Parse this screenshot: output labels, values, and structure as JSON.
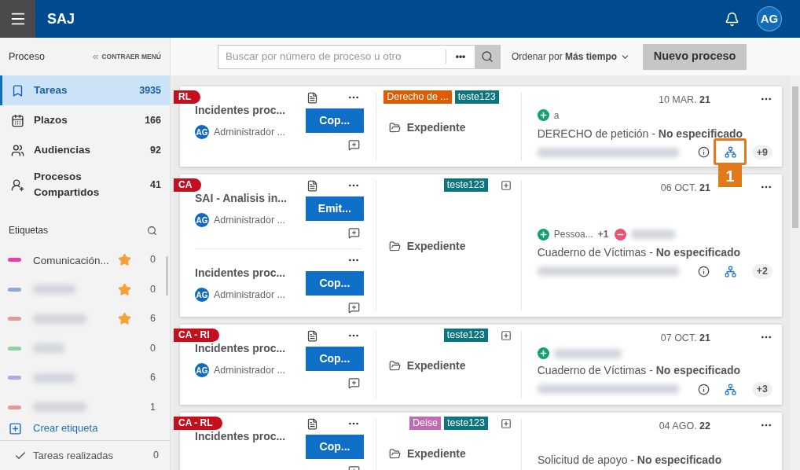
{
  "header": {
    "brand": "SAJ",
    "avatar": "AG"
  },
  "sidebar": {
    "title": "Proceso",
    "collapse": "CONTRAER MENÚ",
    "nav": [
      {
        "kind": "tasks",
        "label": "Tareas",
        "count": "3935",
        "selected": true
      },
      {
        "kind": "deadlines",
        "label": "Plazos",
        "count": "166",
        "selected": false
      },
      {
        "kind": "hearings",
        "label": "Audiencias",
        "count": "92",
        "selected": false
      },
      {
        "kind": "shared",
        "label": "Procesos Compartidos",
        "count": "41",
        "selected": false
      }
    ],
    "labels_title": "Etiquetas",
    "labels": [
      {
        "name": "Comunicación...",
        "color": "#e83fb0",
        "starred": true,
        "count": "0"
      },
      {
        "color": "#8ea8d8",
        "starred": true,
        "count": "0"
      },
      {
        "color": "#e09a9a",
        "starred": true,
        "count": "6"
      },
      {
        "color": "#8fd4a0",
        "starred": false,
        "count": "0"
      },
      {
        "color": "#b9a3e3",
        "starred": false,
        "count": "6"
      },
      {
        "color": "#e09a9a",
        "starred": false,
        "count": "1"
      }
    ],
    "create_label": "Crear etiqueta",
    "done": {
      "label": "Tareas realizadas",
      "count": "0"
    }
  },
  "toolbar": {
    "search_placeholder": "Buscar por número de proceso u otro",
    "more": "•••",
    "sort": "Ordenar por **Más tiempo**",
    "new_button": "Nuevo proceso"
  },
  "cards": [
    {
      "tag": "RL",
      "tasks": [
        {
          "title": "Incidentes proc...",
          "user": {
            "initials": "AG",
            "name": "Administrador ..."
          },
          "action": "Cop...",
          "document": true
        }
      ],
      "labels": [
        {
          "text": "Derecho de ...",
          "color": "#e05a00"
        },
        {
          "text": "teste123",
          "color": "#0b7580"
        }
      ],
      "folder": "Expediente",
      "date": "10 MAR.",
      "year": "21",
      "parties": [
        {
          "kind": "add",
          "text": "a"
        }
      ],
      "subject": "DERECHO de petición - **No especificado**",
      "count": "+9",
      "callout": "1"
    },
    {
      "tag": "CA",
      "tasks": [
        {
          "title": "SAI - Analisis in...",
          "user": {
            "initials": "AG",
            "name": "Administrador ..."
          },
          "action": "Emit...",
          "document": true
        },
        {
          "title": "Incidentes proc...",
          "user": {
            "initials": "AG",
            "name": "Administrador ..."
          },
          "action": "Cop...",
          "document": false
        }
      ],
      "labels": [
        {
          "text": "teste123",
          "color": "#0b7580"
        }
      ],
      "folder": "Expediente",
      "date": "06 OCT.",
      "year": "21",
      "parties": [
        {
          "kind": "add",
          "text": "Pessoa...",
          "more": "+1"
        },
        {
          "kind": "remove"
        }
      ],
      "subject": "Cuaderno de Víctimas - **No especificado**",
      "count": "+2"
    },
    {
      "tag": "CA - RI",
      "tasks": [
        {
          "title": "Incidentes proc...",
          "user": {
            "initials": "AG",
            "name": "Administrador ..."
          },
          "action": "Cop...",
          "document": true
        }
      ],
      "labels": [
        {
          "text": "teste123",
          "color": "#0b7580"
        }
      ],
      "folder": "Expediente",
      "date": "07 OCT.",
      "year": "21",
      "parties": [
        {
          "kind": "add"
        }
      ],
      "subject": "Cuaderno de Víctimas - **No especificado**",
      "count": "+3"
    },
    {
      "tag": "CA - RL",
      "tasks": [
        {
          "title": "Incidentes proc...",
          "action": "Cop...",
          "document": true
        }
      ],
      "labels": [
        {
          "text": "Deise",
          "color": "#c06bb4"
        },
        {
          "text": "teste123",
          "color": "#0b7580"
        }
      ],
      "folder": "Expediente",
      "date": "04 AGO.",
      "year": "22",
      "subject": "Solicitud de apoyo - **No especificado**"
    }
  ]
}
